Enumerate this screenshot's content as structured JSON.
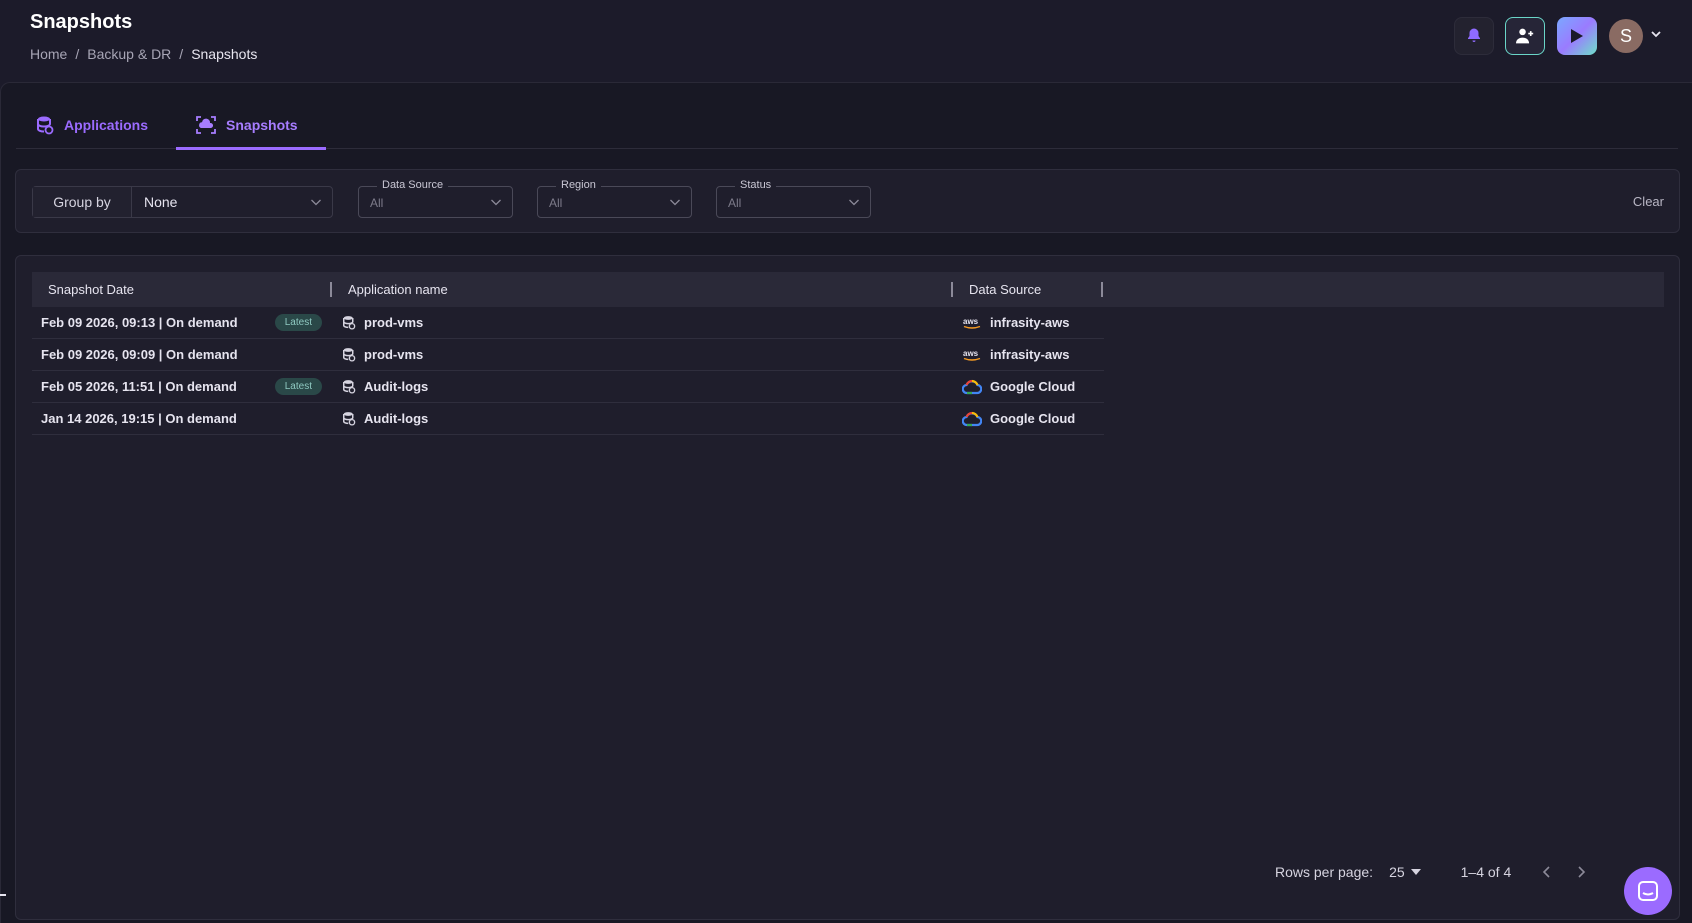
{
  "header": {
    "title": "Snapshots",
    "breadcrumb": [
      "Home",
      "Backup & DR",
      "Snapshots"
    ],
    "breadcrumb_separator": "/",
    "avatar_initial": "S"
  },
  "tabs": [
    {
      "label": "Applications",
      "icon": "database-sync-icon",
      "active": false
    },
    {
      "label": "Snapshots",
      "icon": "cloud-snapshot-icon",
      "active": true
    }
  ],
  "filters": {
    "group_by_label": "Group by",
    "group_by_value": "None",
    "data_source": {
      "label": "Data Source",
      "value": "All"
    },
    "region": {
      "label": "Region",
      "value": "All"
    },
    "status": {
      "label": "Status",
      "value": "All"
    },
    "clear_label": "Clear"
  },
  "table": {
    "columns": [
      "Snapshot Date",
      "Application name",
      "Data Source"
    ],
    "rows": [
      {
        "date": "Feb 09 2026, 09:13 | On demand",
        "badge": "Latest",
        "app": "prod-vms",
        "source": "infrasity-aws",
        "source_icon": "aws-icon"
      },
      {
        "date": "Feb 09 2026, 09:09 | On demand",
        "badge": "",
        "app": "prod-vms",
        "source": "infrasity-aws",
        "source_icon": "aws-icon"
      },
      {
        "date": "Feb 05 2026, 11:51 | On demand",
        "badge": "Latest",
        "app": "Audit-logs",
        "source": "Google Cloud",
        "source_icon": "google-cloud-icon"
      },
      {
        "date": "Jan 14 2026, 19:15 | On demand",
        "badge": "",
        "app": "Audit-logs",
        "source": "Google Cloud",
        "source_icon": "google-cloud-icon"
      }
    ]
  },
  "pagination": {
    "rows_per_page_label": "Rows per page:",
    "rows_per_page_value": "25",
    "range": "1–4 of 4"
  },
  "colors": {
    "accent": "#9b6bff",
    "background": "#1c1b2a",
    "badge_bg": "#2a4848",
    "invite_border": "#6ad6c8"
  }
}
